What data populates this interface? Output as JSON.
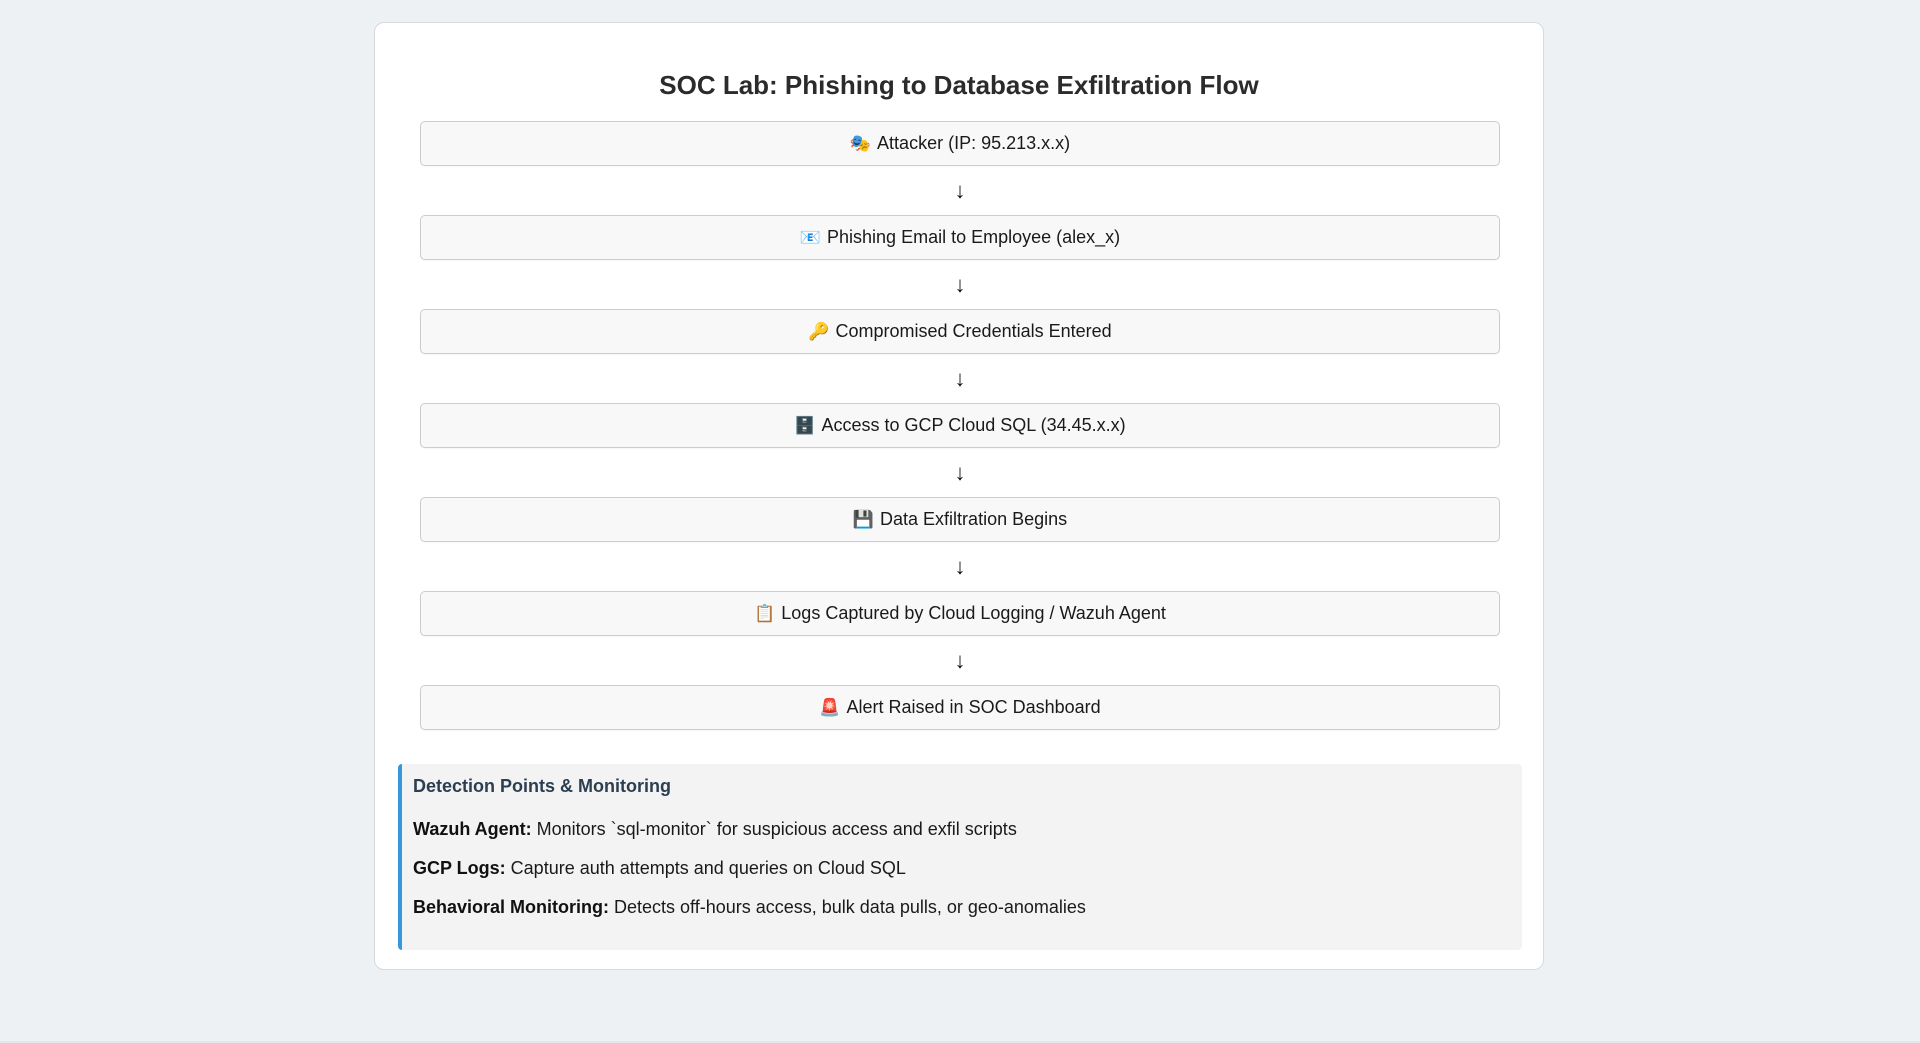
{
  "diagram": {
    "title": "SOC Lab: Phishing to Database Exfiltration Flow",
    "arrow_glyph": "↓",
    "steps": [
      {
        "emoji": "🎭",
        "text": "Attacker (IP: 95.213.x.x)"
      },
      {
        "emoji": "📧",
        "text": "Phishing Email to Employee (alex_x)"
      },
      {
        "emoji": "🔑",
        "text": "Compromised Credentials Entered"
      },
      {
        "emoji": "🗄️",
        "text": "Access to GCP Cloud SQL (34.45.x.x)"
      },
      {
        "emoji": "💾",
        "text": "Data Exfiltration Begins"
      },
      {
        "emoji": "📋",
        "text": "Logs Captured by Cloud Logging / Wazuh Agent"
      },
      {
        "emoji": "🚨",
        "text": "Alert Raised in SOC Dashboard"
      }
    ]
  },
  "detection": {
    "title": "Detection Points & Monitoring",
    "items": [
      {
        "label": "Wazuh Agent:",
        "text": " Monitors `sql-monitor` for suspicious access and exfil scripts"
      },
      {
        "label": "GCP Logs:",
        "text": " Capture auth attempts and queries on Cloud SQL"
      },
      {
        "label": "Behavioral Monitoring:",
        "text": " Detects off-hours access, bulk data pulls, or geo-anomalies"
      }
    ]
  },
  "colors": {
    "page_background": "#eef1f4",
    "card_background": "#ffffff",
    "accent": "#3498db",
    "detection_title": "#2c3e50"
  }
}
